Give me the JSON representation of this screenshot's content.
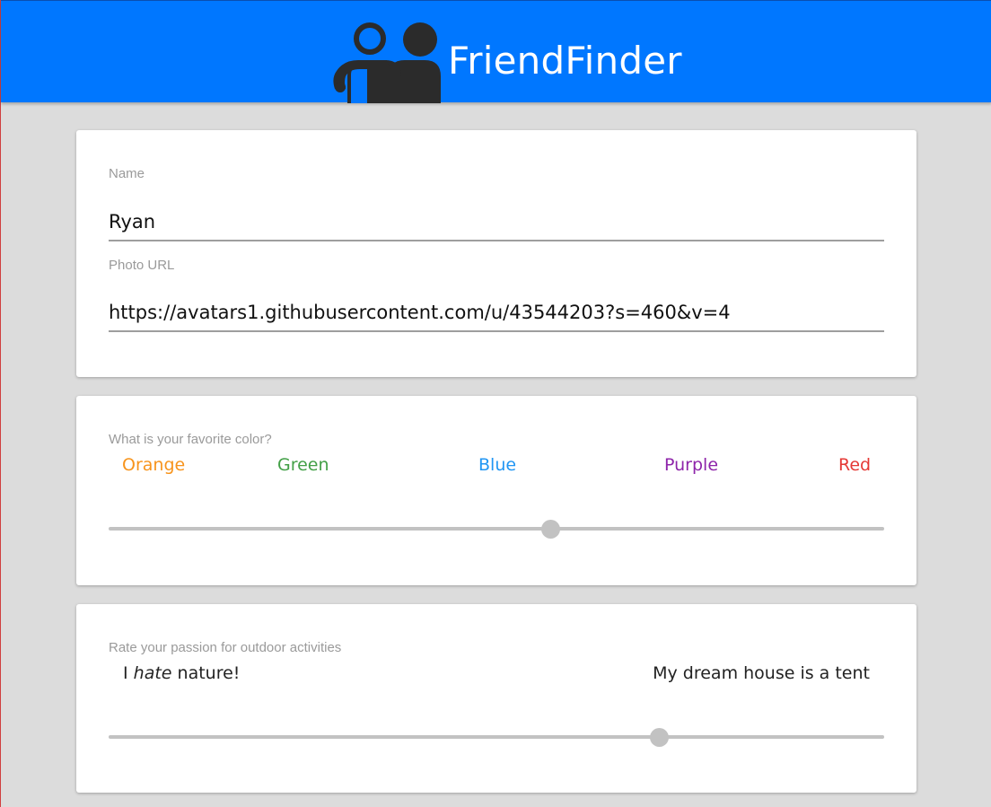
{
  "header": {
    "brand": "FriendFinder",
    "logo_icon": "two-people-icon",
    "background_color": "#0077ff"
  },
  "form": {
    "name": {
      "label": "Name",
      "value": "Ryan"
    },
    "photo_url": {
      "label": "Photo URL",
      "value": "https://avatars1.githubusercontent.com/u/43544203?s=460&v=4"
    }
  },
  "color_question": {
    "label": "What is your favorite color?",
    "options": [
      {
        "text": "Orange",
        "color": "#f7941d"
      },
      {
        "text": "Green",
        "color": "#43a047"
      },
      {
        "text": "Blue",
        "color": "#2196f3"
      },
      {
        "text": "Purple",
        "color": "#8e24aa"
      },
      {
        "text": "Red",
        "color": "#e53935"
      }
    ],
    "slider_value": 0.57
  },
  "outdoor_question": {
    "label": "Rate your passion for outdoor activities",
    "low_prefix": "I ",
    "low_emphasis": "hate",
    "low_suffix": " nature!",
    "high_label": "My dream house is a tent",
    "slider_value": 0.71
  }
}
